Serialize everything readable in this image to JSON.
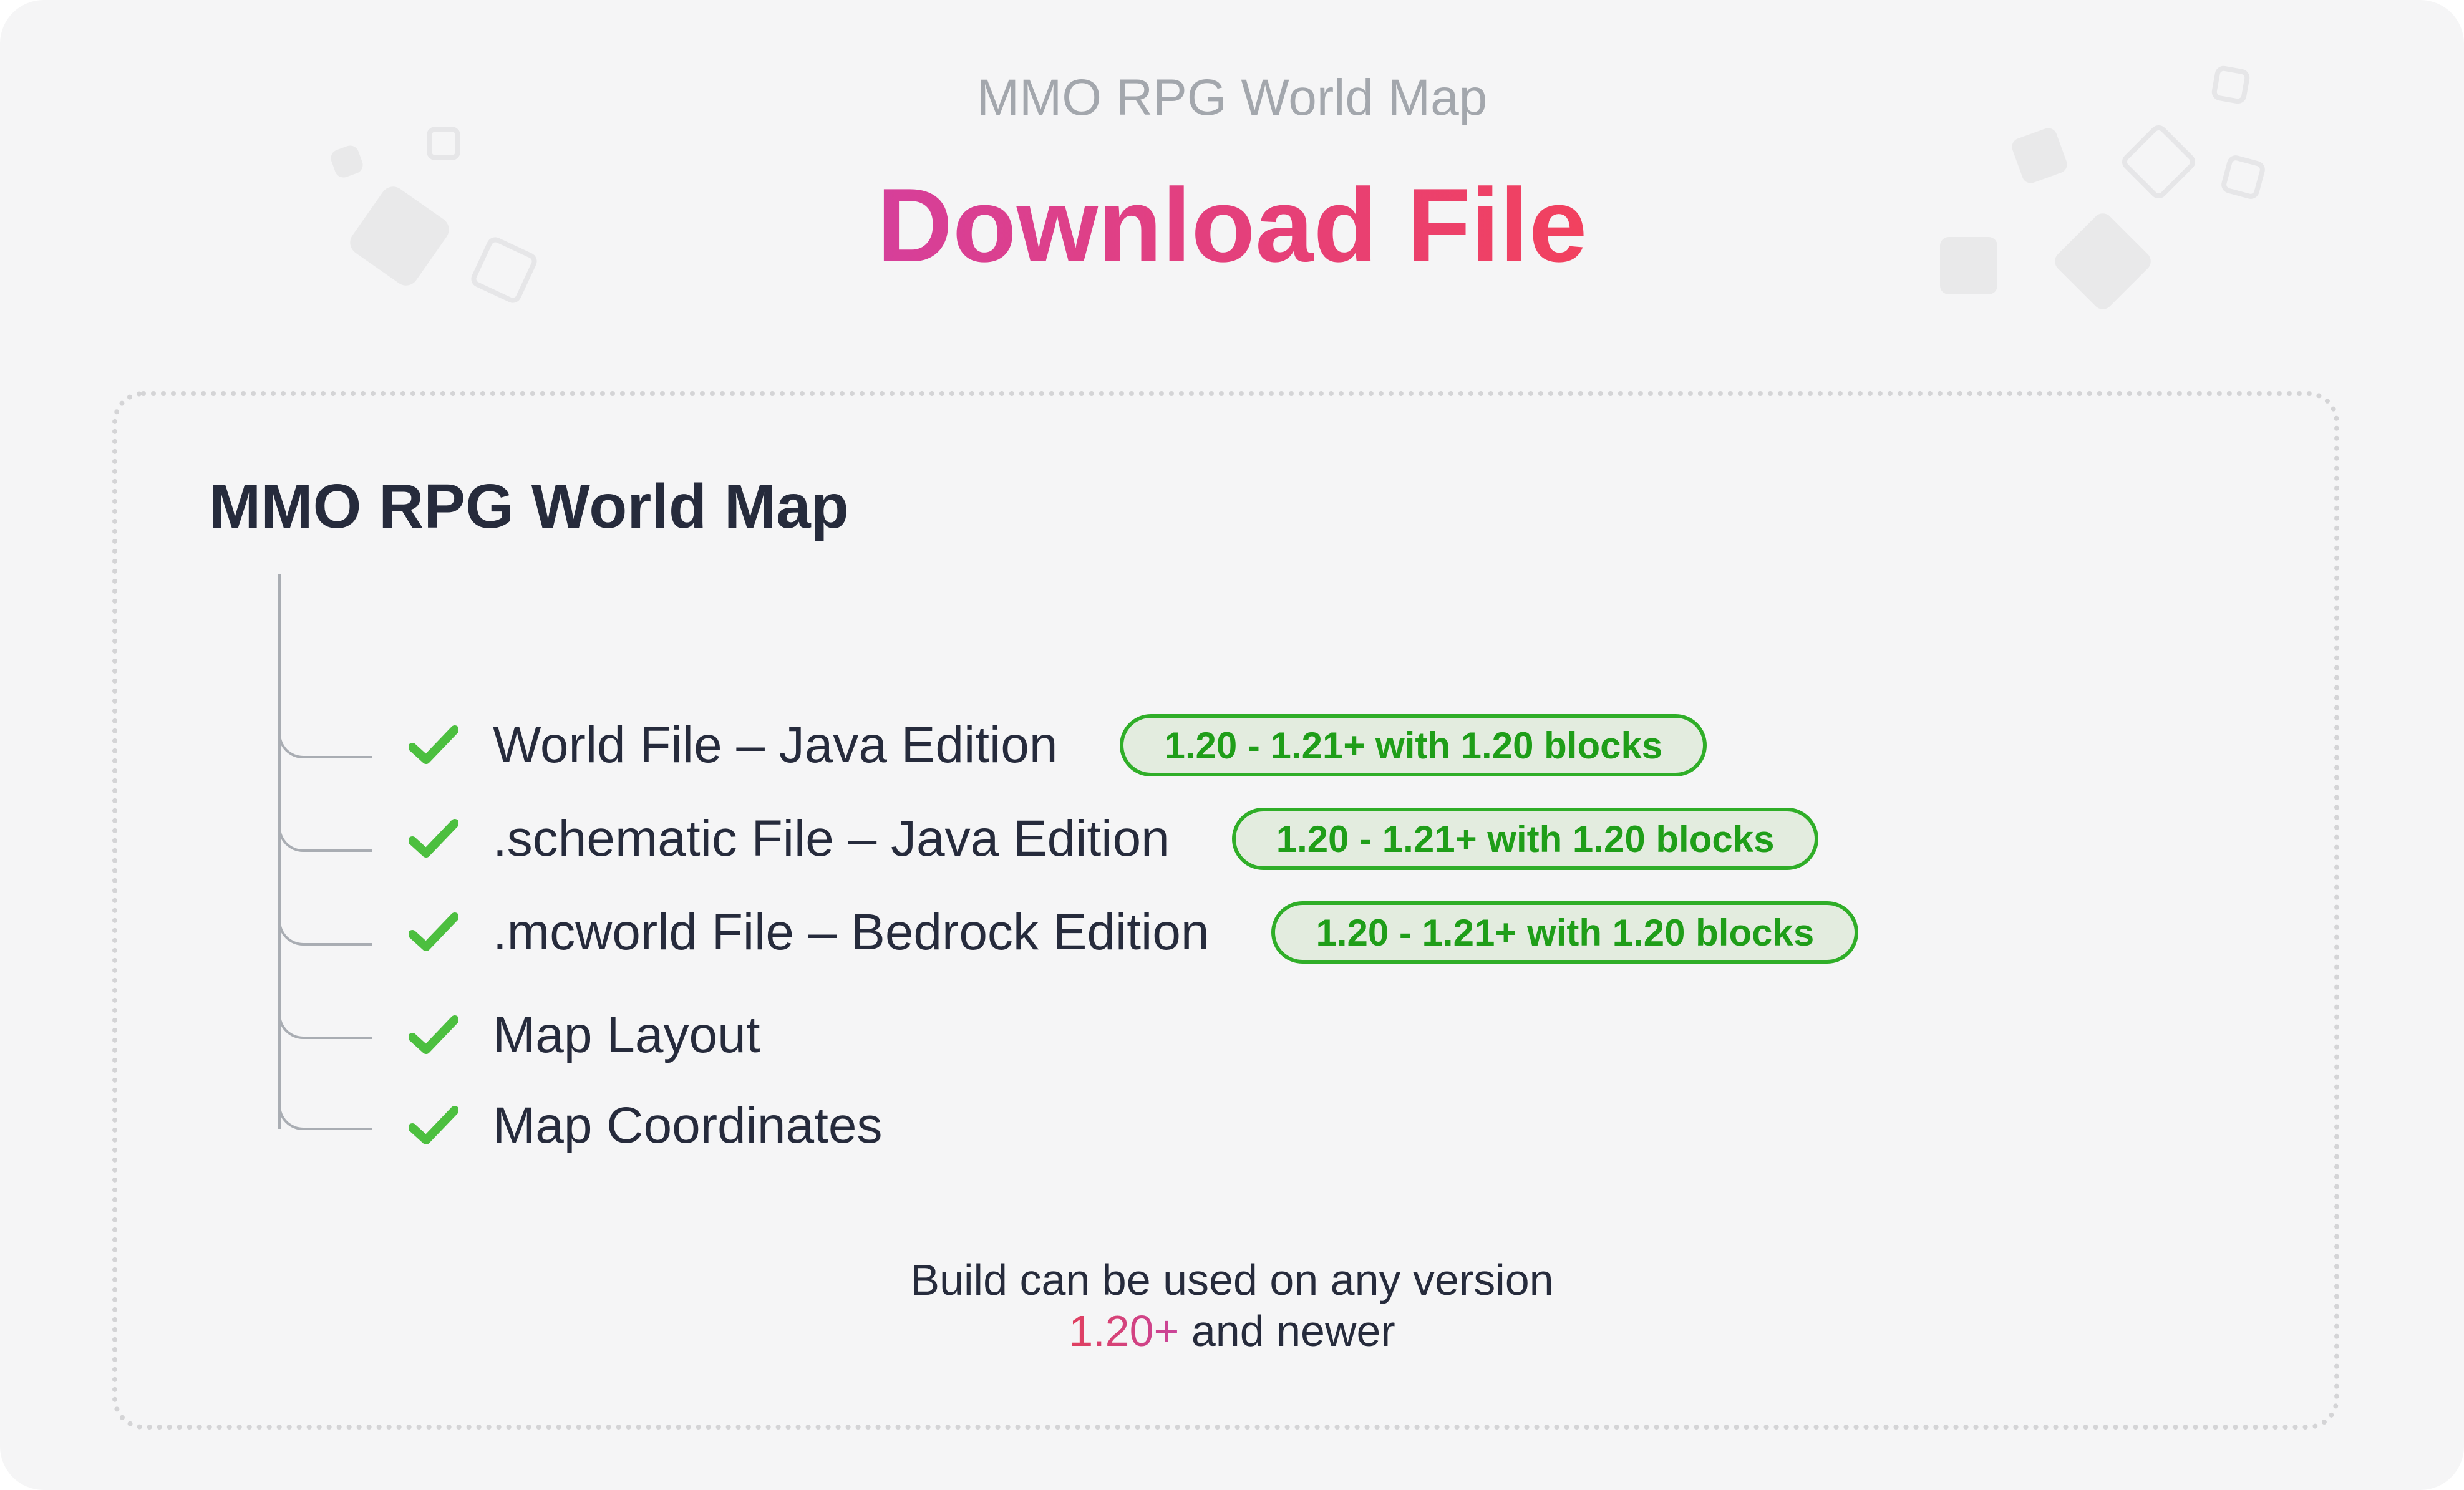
{
  "header": {
    "subtitle": "MMO RPG World Map",
    "title": "Download File"
  },
  "card": {
    "title": "MMO RPG World Map",
    "items": [
      {
        "label": "World File – Java Edition",
        "badge": "1.20 - 1.21+ with 1.20 blocks"
      },
      {
        "label": ".schematic File – Java Edition",
        "badge": "1.20 - 1.21+ with 1.20 blocks"
      },
      {
        "label": ".mcworld File – Bedrock Edition",
        "badge": "1.20 - 1.21+ with 1.20 blocks"
      },
      {
        "label": "Map Layout"
      },
      {
        "label": "Map Coordinates"
      }
    ],
    "footer": {
      "line1": "Build can be used on any version",
      "version": "1.20+",
      "line2_rest": " and newer"
    }
  },
  "colors": {
    "title_gradient_start": "#d63f9a",
    "title_gradient_end": "#f2415e",
    "check_green": "#4cbf3f",
    "badge_border": "#2fae28",
    "badge_text": "#1f9e19",
    "badge_bg": "#e3ecdf"
  },
  "icons": {
    "check": "check-icon"
  }
}
